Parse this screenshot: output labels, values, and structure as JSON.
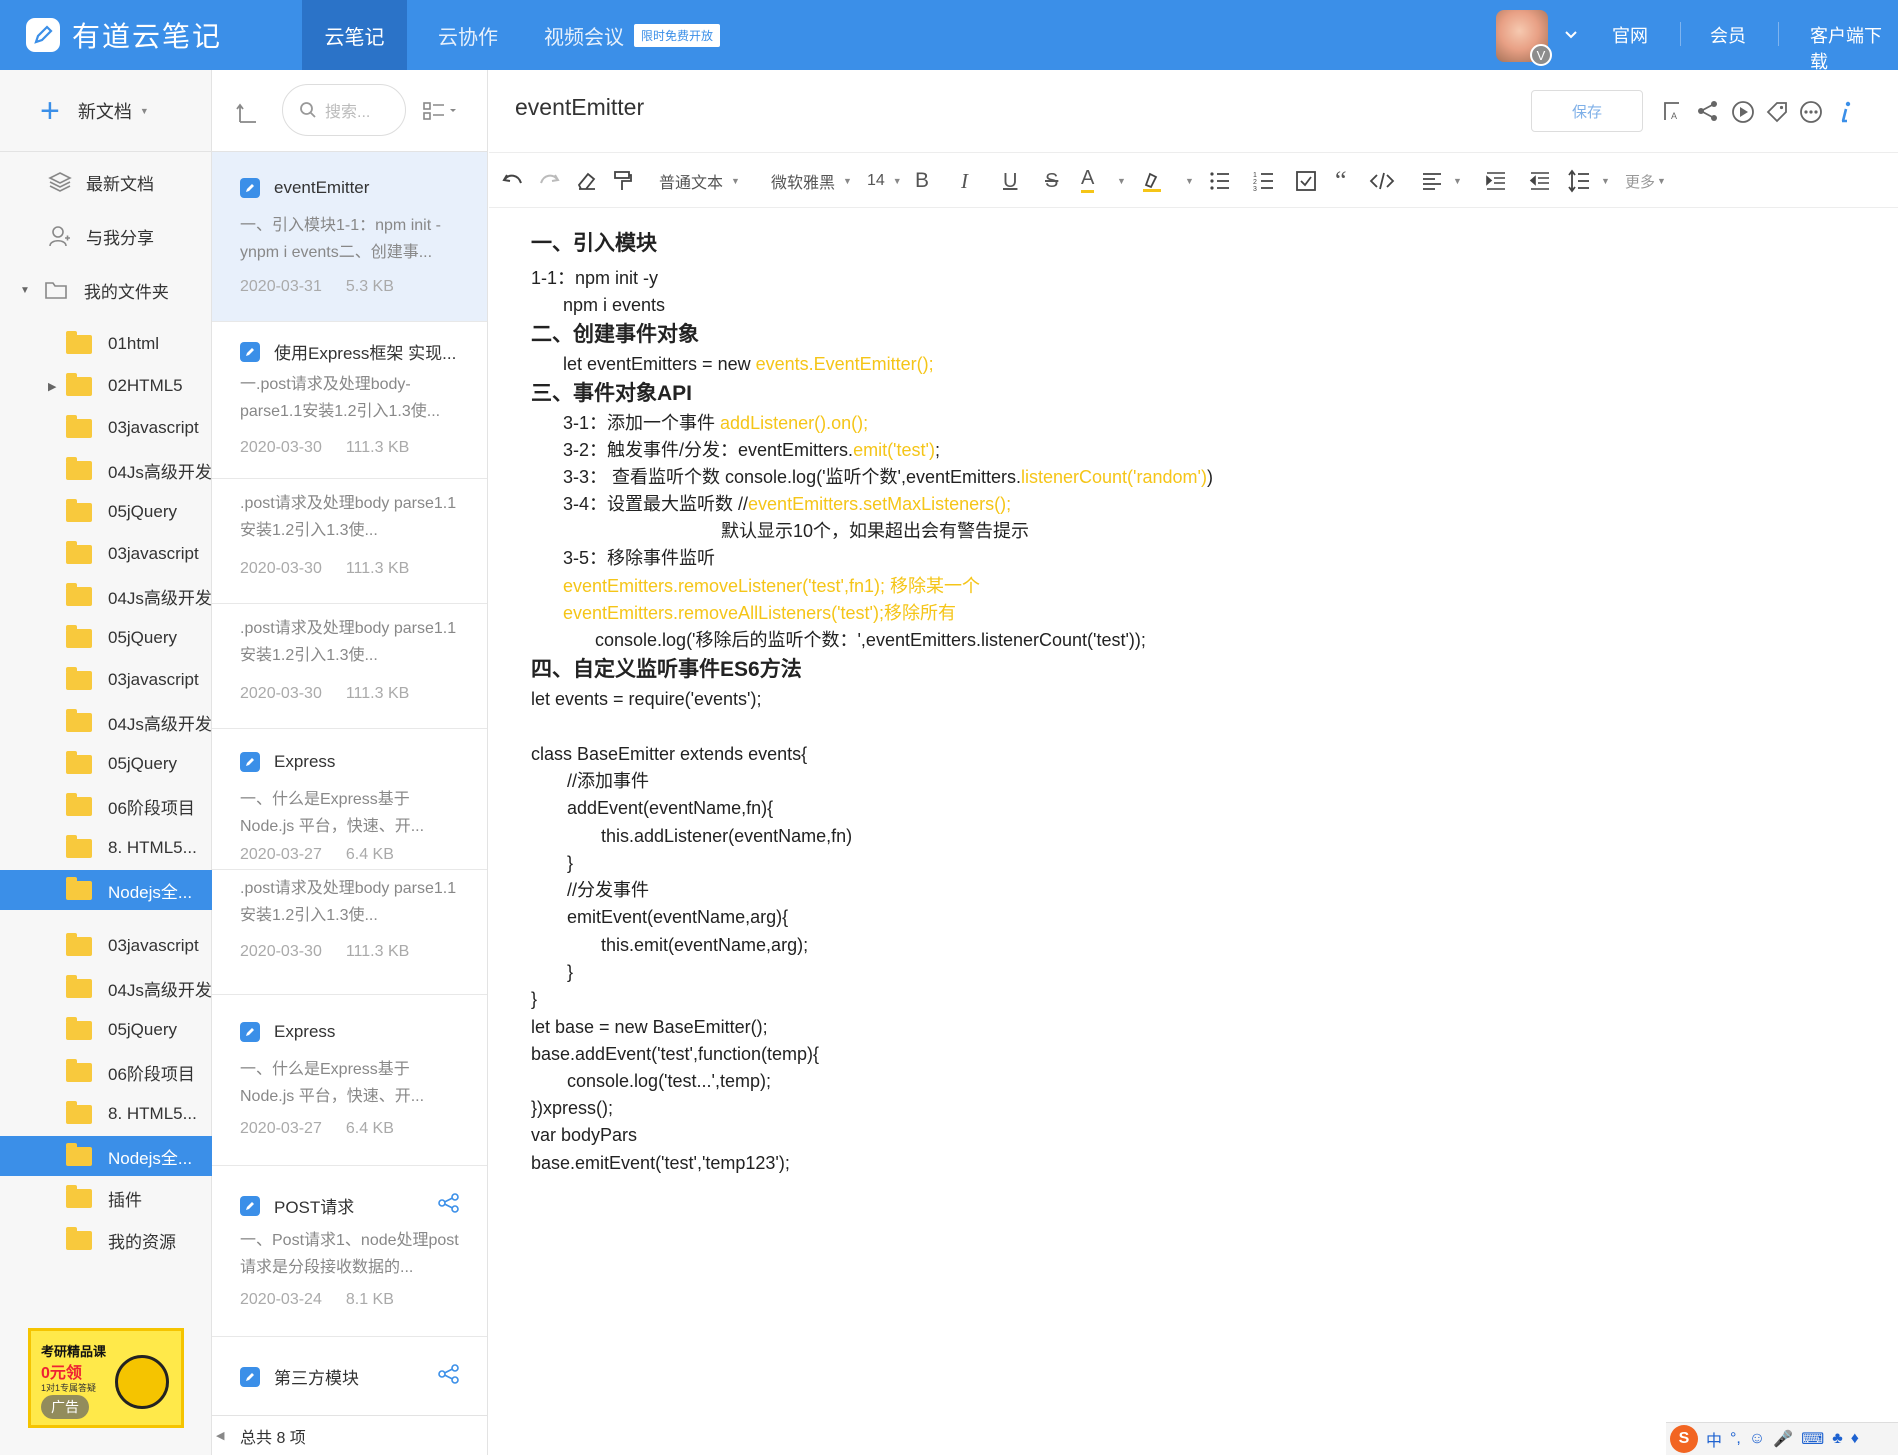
{
  "app": {
    "name": "有道云笔记",
    "nav": [
      "云笔记",
      "云协作",
      "视频会议"
    ],
    "promo": "限时免费开放",
    "avatar_badge": "V",
    "links": [
      "官网",
      "会员",
      "客户端下载"
    ]
  },
  "sidebar": {
    "new_doc": "新文档",
    "nav": [
      "最新文档",
      "与我分享",
      "我的文件夹"
    ],
    "folders": [
      "01html",
      "02HTML5",
      "03javascript",
      "04Js高级开发",
      "05jQuery",
      "03javascript",
      "04Js高级开发",
      "05jQuery",
      "03javascript",
      "04Js高级开发",
      "05jQuery",
      "06阶段项目",
      "8. HTML5...",
      "Nodejs全...",
      "03javascript",
      "04Js高级开发",
      "05jQuery",
      "06阶段项目",
      "8. HTML5...",
      "Nodejs全...",
      "插件",
      "我的资源"
    ],
    "ad": {
      "line1": "考研精品课",
      "line2": "0元领",
      "line3": "1对1专属答疑",
      "tag": "广告"
    }
  },
  "list": {
    "search_placeholder": "搜索...",
    "items": [
      {
        "title": "eventEmitter",
        "snippet": "一、引入模块1-1：npm init -ynpm i events二、创建事...",
        "date": "2020-03-31",
        "size": "5.3 KB"
      },
      {
        "title": "使用Express框架 实现...",
        "snippet": "一.post请求及处理body-parse1.1安装1.2引入1.3使...",
        "date": "2020-03-30",
        "size": "111.3 KB"
      },
      {
        "title": "",
        "snippet": ".post请求及处理body parse1.1安装1.2引入1.3使...",
        "date": "2020-03-30",
        "size": "111.3 KB"
      },
      {
        "title": "",
        "snippet": ".post请求及处理body parse1.1安装1.2引入1.3使...",
        "date": "2020-03-30",
        "size": "111.3 KB"
      },
      {
        "title": "Express",
        "snippet": "一、什么是Express基于 Node.js 平台，快速、开...",
        "date": "2020-03-27",
        "size": "6.4 KB"
      },
      {
        "title": "",
        "snippet": ".post请求及处理body parse1.1安装1.2引入1.3使...",
        "date": "2020-03-30",
        "size": "111.3 KB"
      },
      {
        "title": "Express",
        "snippet": "一、什么是Express基于 Node.js 平台，快速、开...",
        "date": "2020-03-27",
        "size": "6.4 KB"
      },
      {
        "title": "POST请求",
        "snippet": "一、Post请求1、node处理post请求是分段接收数据的...",
        "date": "2020-03-24",
        "size": "8.1 KB"
      },
      {
        "title": "第三方模块",
        "snippet": "",
        "date": "",
        "size": ""
      }
    ],
    "footer": "总共 8 项"
  },
  "editor": {
    "title": "eventEmitter",
    "save": "保存",
    "toolbar": {
      "para": "普通文本",
      "font": "微软雅黑",
      "size": "14",
      "more": "更多"
    },
    "lines": [
      {
        "t": "一、引入模块"
      },
      {
        "t": "1-1：npm init -y"
      },
      {
        "t": "npm i events"
      },
      {
        "t": "二、创建事件对象"
      },
      {
        "t": "let eventEmitters = new ",
        "y": "events.EventEmitter();"
      },
      {
        "t": "三、事件对象API"
      },
      {
        "t": "3-1：添加一个事件 ",
        "y": "addListener().on();"
      },
      {
        "t": "3-2：触发事件/分发：eventEmitters.",
        "y": "emit('test')",
        "r": ";"
      },
      {
        "t": "3-3： 查看监听个数 console.log('监听个数',eventEmitters.",
        "y": "listenerCount('random')",
        "r": ")"
      },
      {
        "t": "3-4：设置最大监听数 //",
        "y": "eventEmitters.setMaxListeners();"
      },
      {
        "t": "默认显示10个，如果超出会有警告提示"
      },
      {
        "t": "3-5：移除事件监听"
      },
      {
        "y": "eventEmitters.removeListener('test',fn1); 移除某一个"
      },
      {
        "y": "eventEmitters.removeAllListeners('test');移除所有"
      },
      {
        "t": "console.log('移除后的监听个数：',eventEmitters.listenerCount('test'));"
      },
      {
        "t": "四、自定义监听事件ES6方法"
      },
      {
        "t": "let events = require('events');"
      },
      {
        "t": "class BaseEmitter extends events{"
      },
      {
        "t": "//添加事件"
      },
      {
        "t": "addEvent(eventName,fn){"
      },
      {
        "t": "this.addListener(eventName,fn)"
      },
      {
        "t": "}"
      },
      {
        "t": "//分发事件"
      },
      {
        "t": "emitEvent(eventName,arg){"
      },
      {
        "t": "this.emit(eventName,arg);"
      },
      {
        "t": "}"
      },
      {
        "t": "}"
      },
      {
        "t": "let base = new BaseEmitter();"
      },
      {
        "t": "base.addEvent('test',function(temp){"
      },
      {
        "t": "console.log('test...',temp);"
      },
      {
        "t": "})xpress();"
      },
      {
        "t": "var bodyPars"
      },
      {
        "t": "base.emitEvent('test','temp123');"
      }
    ]
  },
  "ime": {
    "lang": "中",
    "punct": "°,"
  }
}
